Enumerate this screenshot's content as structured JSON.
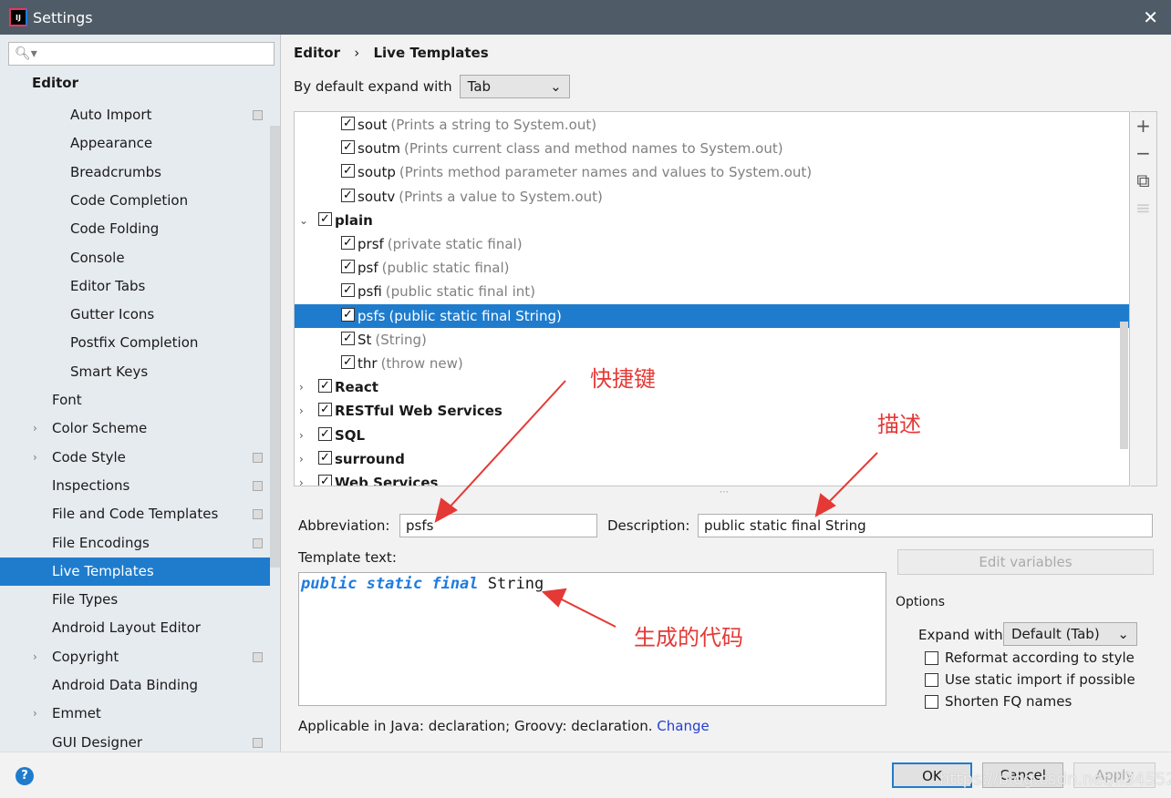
{
  "window": {
    "title": "Settings",
    "close": "✕"
  },
  "sidebar": {
    "search_placeholder": "",
    "section": "Editor",
    "items": [
      {
        "label": "Auto Import",
        "level": 2,
        "copy": true
      },
      {
        "label": "Appearance",
        "level": 2
      },
      {
        "label": "Breadcrumbs",
        "level": 2
      },
      {
        "label": "Code Completion",
        "level": 2
      },
      {
        "label": "Code Folding",
        "level": 2
      },
      {
        "label": "Console",
        "level": 2
      },
      {
        "label": "Editor Tabs",
        "level": 2
      },
      {
        "label": "Gutter Icons",
        "level": 2
      },
      {
        "label": "Postfix Completion",
        "level": 2
      },
      {
        "label": "Smart Keys",
        "level": 2
      },
      {
        "label": "Font",
        "level": 1
      },
      {
        "label": "Color Scheme",
        "level": 1,
        "expandable": true
      },
      {
        "label": "Code Style",
        "level": 1,
        "expandable": true,
        "copy": true
      },
      {
        "label": "Inspections",
        "level": 1,
        "copy": true
      },
      {
        "label": "File and Code Templates",
        "level": 1,
        "copy": true
      },
      {
        "label": "File Encodings",
        "level": 1,
        "copy": true
      },
      {
        "label": "Live Templates",
        "level": 1,
        "selected": true
      },
      {
        "label": "File Types",
        "level": 1
      },
      {
        "label": "Android Layout Editor",
        "level": 1
      },
      {
        "label": "Copyright",
        "level": 1,
        "expandable": true,
        "copy": true
      },
      {
        "label": "Android Data Binding",
        "level": 1
      },
      {
        "label": "Emmet",
        "level": 1,
        "expandable": true
      },
      {
        "label": "GUI Designer",
        "level": 1,
        "copy": true
      }
    ]
  },
  "breadcrumb": {
    "parent": "Editor",
    "sep": "›",
    "current": "Live Templates"
  },
  "expand_default": {
    "label": "By default expand with",
    "value": "Tab"
  },
  "tree": [
    {
      "name": "sout",
      "desc": "(Prints a string to System.out)",
      "child": true
    },
    {
      "name": "soutm",
      "desc": "(Prints current class and method names to System.out)",
      "child": true
    },
    {
      "name": "soutp",
      "desc": "(Prints method parameter names and values to System.out)",
      "child": true
    },
    {
      "name": "soutv",
      "desc": "(Prints a value to System.out)",
      "child": true
    },
    {
      "name": "plain",
      "desc": "",
      "child": false,
      "expanded": true
    },
    {
      "name": "prsf",
      "desc": "(private static final)",
      "child": true
    },
    {
      "name": "psf",
      "desc": "(public static final)",
      "child": true
    },
    {
      "name": "psfi",
      "desc": "(public static final int)",
      "child": true
    },
    {
      "name": "psfs",
      "desc": "(public static final String)",
      "child": true,
      "selected": true
    },
    {
      "name": "St",
      "desc": "(String)",
      "child": true
    },
    {
      "name": "thr",
      "desc": "(throw new)",
      "child": true
    },
    {
      "name": "React",
      "desc": "",
      "child": false
    },
    {
      "name": "RESTful Web Services",
      "desc": "",
      "child": false
    },
    {
      "name": "SQL",
      "desc": "",
      "child": false
    },
    {
      "name": "surround",
      "desc": "",
      "child": false
    },
    {
      "name": "Web Services",
      "desc": "",
      "child": false
    }
  ],
  "toolbar": {
    "add": "+",
    "remove": "−",
    "copy": "⧉",
    "restore": "≡"
  },
  "editor": {
    "abbr_label": "Abbreviation:",
    "abbr": "psfs",
    "desc_label": "Description:",
    "desc": "public static final String",
    "template_label": "Template text:",
    "kw1": "public",
    "kw2": "static",
    "kw3": "final",
    "rest": "String",
    "edit_vars": "Edit variables",
    "applicable": "Applicable in Java: declaration; Groovy: declaration.",
    "change": "Change"
  },
  "options": {
    "title": "Options",
    "expand_label": "Expand with",
    "expand_value": "Default (Tab)",
    "reformat": "Reformat according to style",
    "static_import": "Use static import if possible",
    "shorten": "Shorten FQ names"
  },
  "footer": {
    "help": "?",
    "ok": "OK",
    "cancel": "Cancel",
    "apply": "Apply",
    "watermark": "https://blog.csdn.net/li3455277925"
  },
  "annotations": {
    "shortcut": "快捷键",
    "description": "描述",
    "generated": "生成的代码",
    "color": "#e53935"
  },
  "colors": {
    "accent": "#1f7ccd",
    "titlebar": "#4f5b66",
    "keyword": "#1f7ce0"
  }
}
